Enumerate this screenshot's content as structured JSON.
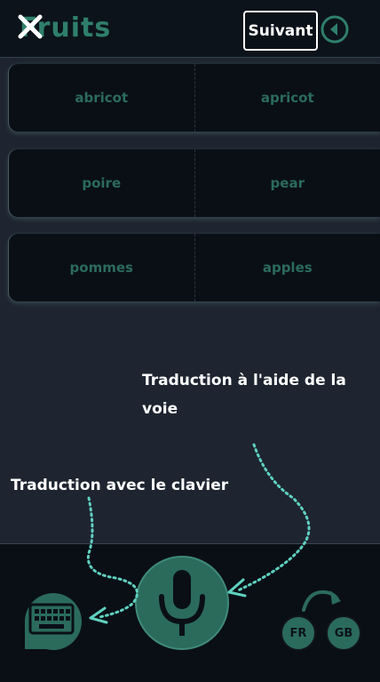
{
  "header": {
    "title": "Fruits",
    "next_label": "Suivant",
    "icons": {
      "close": "close-icon",
      "back": "back-circle-icon"
    }
  },
  "cards": [
    {
      "left": "abricot",
      "right": "apricot"
    },
    {
      "left": "poire",
      "right": "pear"
    },
    {
      "left": "pommes",
      "right": "apples"
    }
  ],
  "hints": {
    "voice": "Traduction à l'aide de la voie",
    "keyboard": "Traduction avec le clavier"
  },
  "bottom": {
    "lang_from": "FR",
    "lang_to": "GB",
    "icons": {
      "keyboard": "keyboard-icon",
      "mic": "microphone-icon",
      "swap": "swap-arrow-icon"
    }
  },
  "colors": {
    "accent": "#2b6b5c",
    "background": "#1e2530",
    "panel": "#0a0f16",
    "arrow": "#5fd1c0"
  }
}
